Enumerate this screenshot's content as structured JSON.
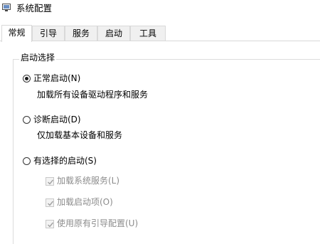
{
  "window": {
    "title": "系统配置",
    "icon": "system-config-icon"
  },
  "tabs": [
    {
      "label": "常规",
      "active": true
    },
    {
      "label": "引导",
      "active": false
    },
    {
      "label": "服务",
      "active": false
    },
    {
      "label": "启动",
      "active": false
    },
    {
      "label": "工具",
      "active": false
    }
  ],
  "startup_selection": {
    "group_title": "启动选择",
    "options": [
      {
        "label": "正常启动(N)",
        "description": "加载所有设备驱动程序和服务",
        "selected": true
      },
      {
        "label": "诊断启动(D)",
        "description": "仅加载基本设备和服务",
        "selected": false
      },
      {
        "label": "有选择的启动(S)",
        "selected": false
      }
    ],
    "selective_items": [
      {
        "label": "加载系统服务(L)",
        "checked": true,
        "enabled": false
      },
      {
        "label": "加载启动项(O)",
        "checked": true,
        "enabled": false
      },
      {
        "label": "使用原有引导配置(U)",
        "checked": true,
        "enabled": false
      }
    ]
  },
  "colors": {
    "disabled_text": "#8c8c8c",
    "disabled_check": "#a0a0a0",
    "border": "#d9d9d9"
  }
}
